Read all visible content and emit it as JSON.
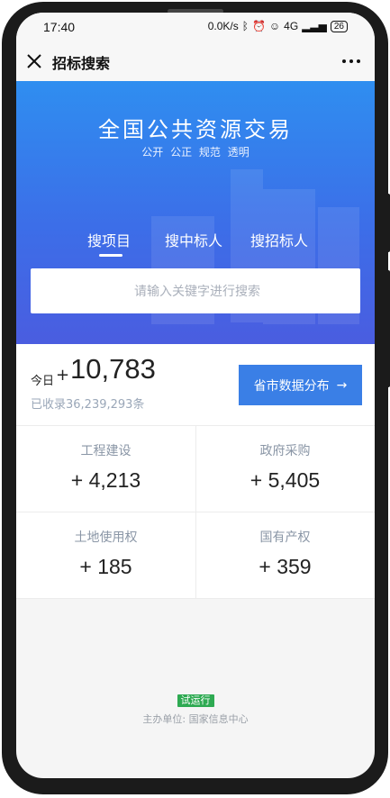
{
  "status": {
    "time": "17:40",
    "speed": "0.0K/s",
    "network": "4G",
    "battery": "26"
  },
  "titlebar": {
    "title": "招标搜索"
  },
  "hero": {
    "title": "全国公共资源交易",
    "subtitle": "公开 公正 规范 透明",
    "tabs": [
      "搜项目",
      "搜中标人",
      "搜招标人"
    ],
    "search_placeholder": "请输入关键字进行搜索"
  },
  "today": {
    "label": "今日",
    "plus": "+",
    "count": "10,783",
    "collected": "已收录36,239,293条",
    "dist_button": "省市数据分布",
    "dist_arrow": "→"
  },
  "categories": [
    {
      "name": "工程建设",
      "value": "+ 4,213"
    },
    {
      "name": "政府采购",
      "value": "+ 5,405"
    },
    {
      "name": "土地使用权",
      "value": "+ 185"
    },
    {
      "name": "国有产权",
      "value": "+ 359"
    }
  ],
  "footer": {
    "badge": "试运行",
    "org": "主办单位: 国家信息中心"
  },
  "colors": {
    "hero_top": "#2f8ef0",
    "hero_bottom": "#4a5de0",
    "button": "#3a7fe6",
    "badge": "#2eaa52"
  }
}
